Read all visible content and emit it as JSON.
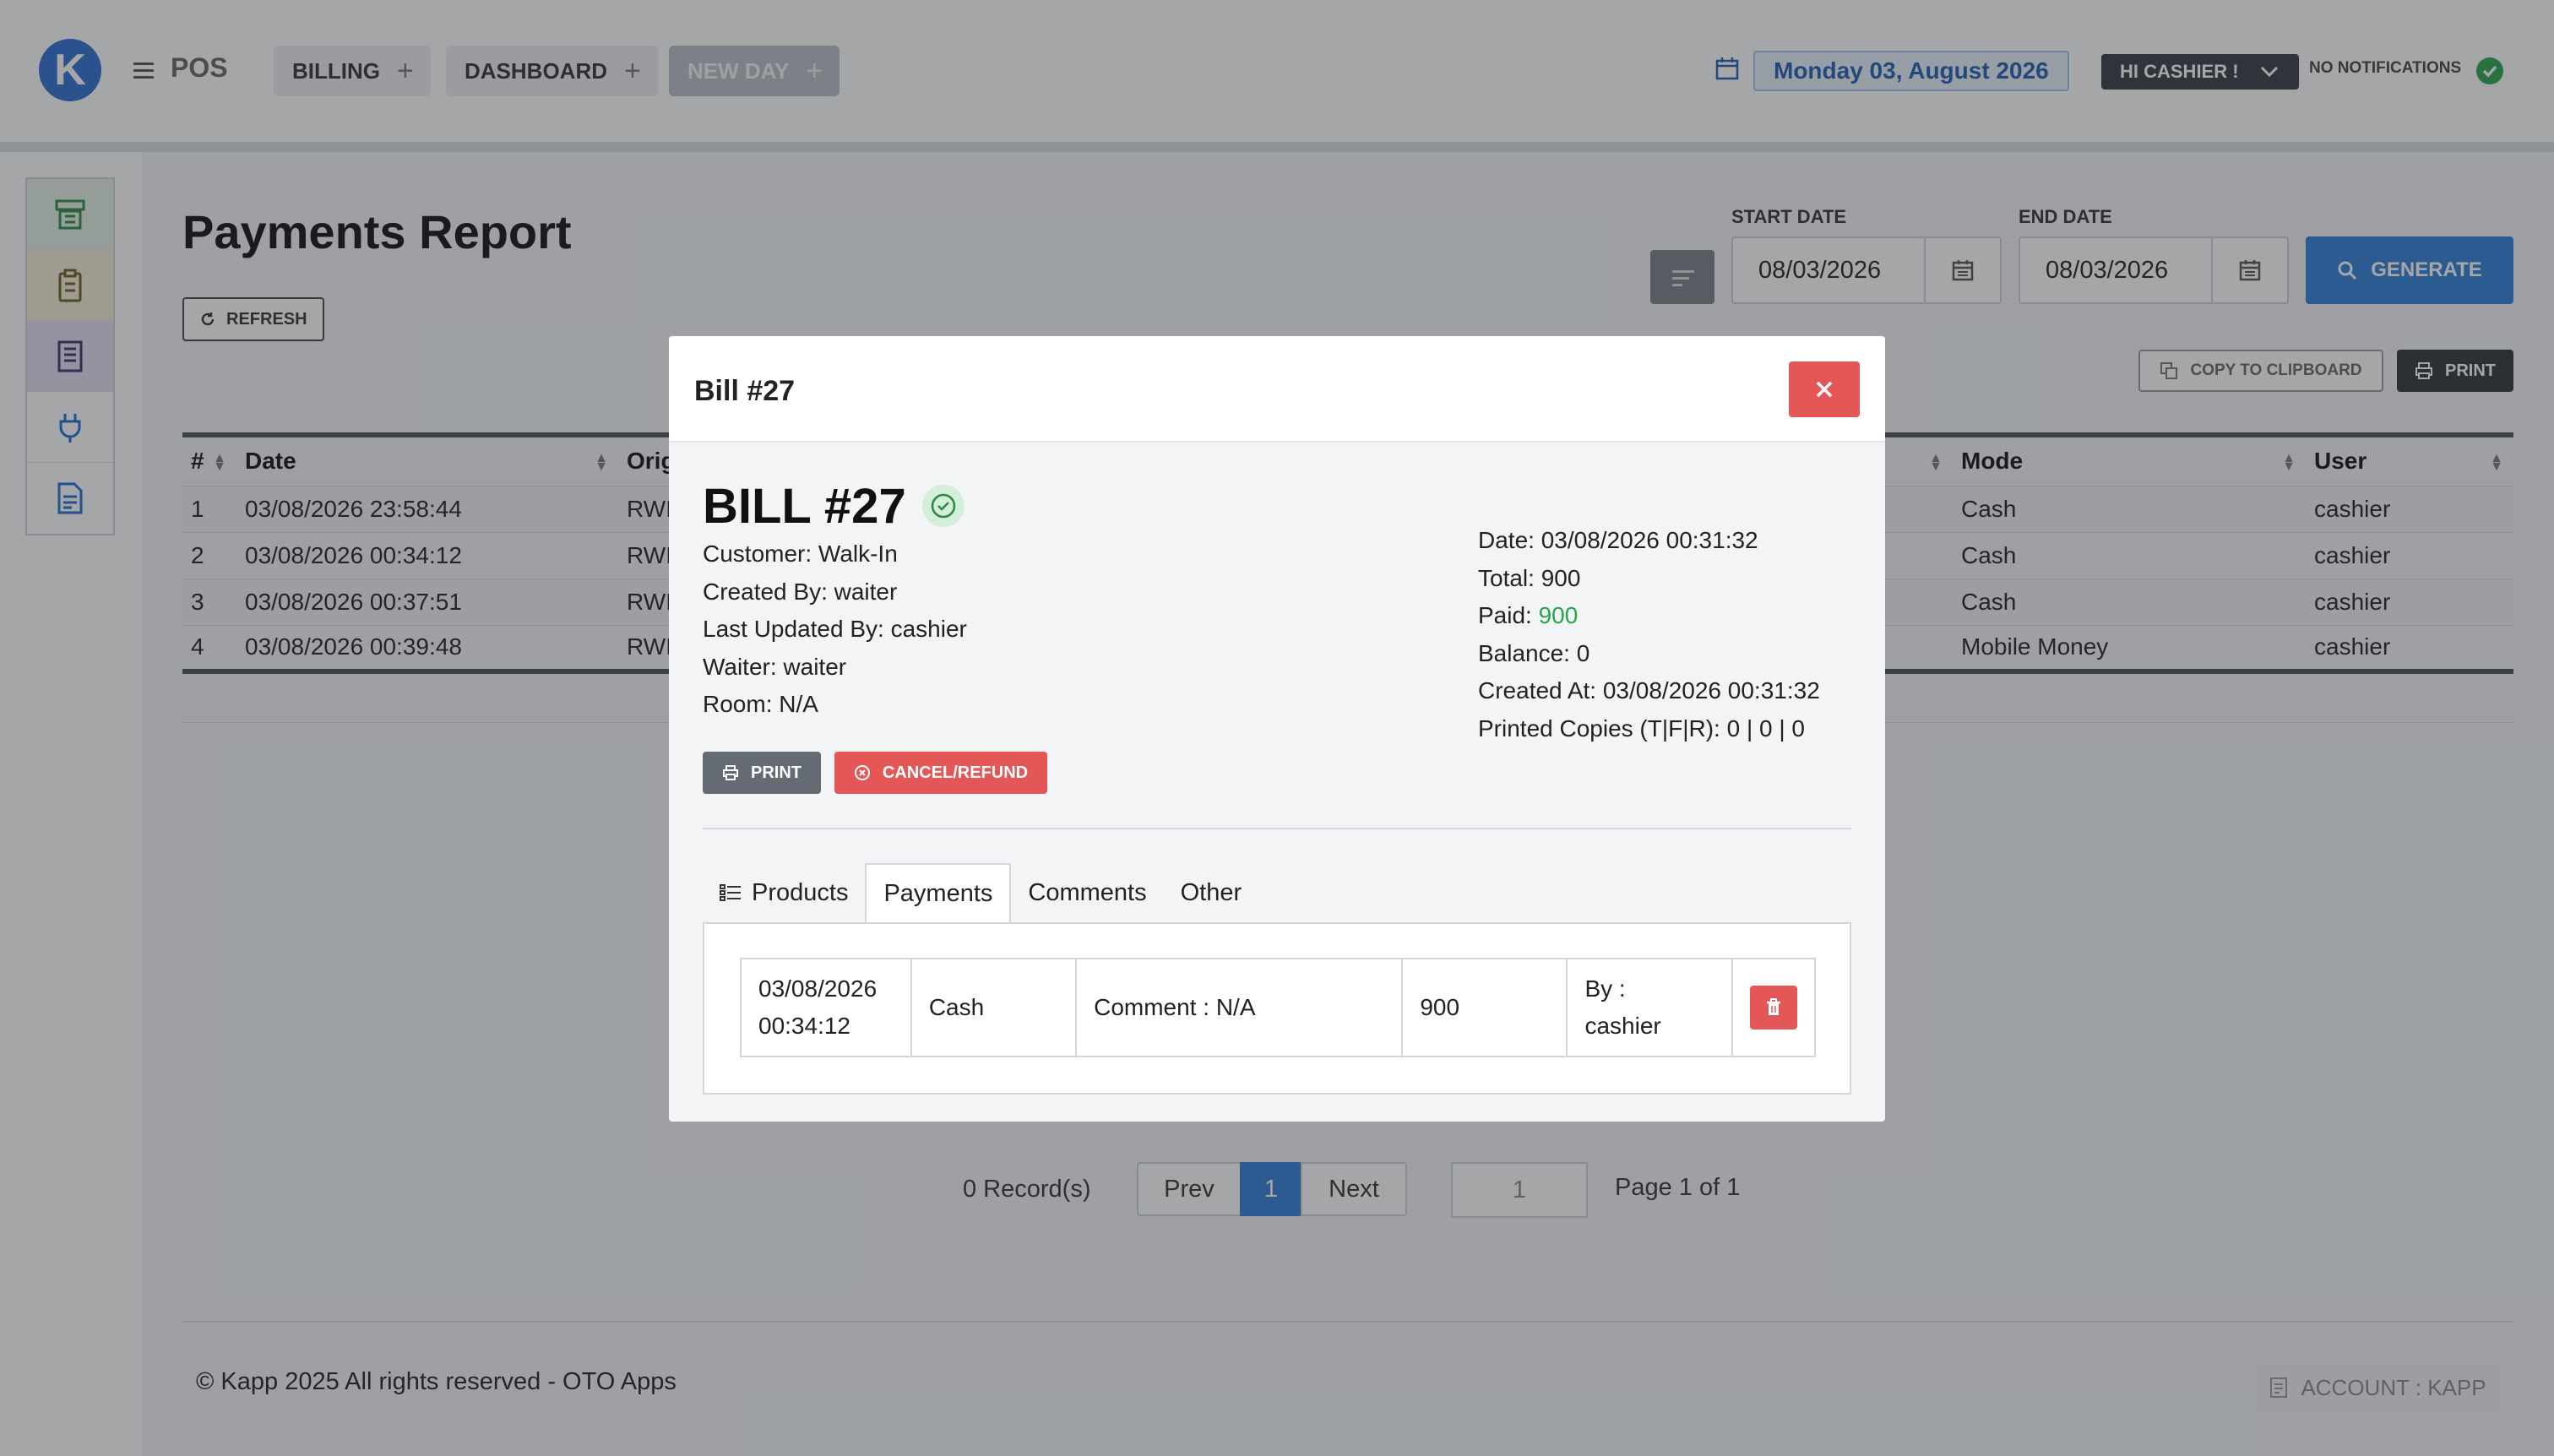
{
  "topbar": {
    "logo_letter": "K",
    "app_name": "POS",
    "tabs": [
      {
        "label": "BILLING",
        "plus": "+"
      },
      {
        "label": "DASHBOARD",
        "plus": "+"
      },
      {
        "label": "NEW DAY",
        "plus": "+"
      }
    ],
    "date": "Monday 03, August 2026",
    "user": "HI CASHIER !",
    "notifications": "NO NOTIFICATIONS"
  },
  "sidebar": {
    "items": [
      {
        "icon": "cash-register-icon",
        "color": "#2c8a4a"
      },
      {
        "icon": "clipboard-icon",
        "color": "#7a6a20"
      },
      {
        "icon": "receipt-icon",
        "color": "#4a3a7a"
      },
      {
        "icon": "plug-icon",
        "color": "#1e6fd0"
      },
      {
        "icon": "document-icon",
        "color": "#1e6fd0"
      }
    ]
  },
  "main": {
    "title": "Payments Report",
    "refresh_label": "REFRESH",
    "start_date_label": "START DATE",
    "start_date": "08/03/2026",
    "end_date_label": "END DATE",
    "end_date": "08/03/2026",
    "generate_label": "GENERATE",
    "copy_label": "COPY TO CLIPBOARD",
    "print_label": "PRINT",
    "table": {
      "columns": [
        "#",
        "Date",
        "Orig",
        "Mode",
        "User"
      ],
      "rows": [
        {
          "num": "1",
          "date": "03/08/2026 23:58:44",
          "orig": "RWI",
          "mode": "Cash",
          "user": "cashier"
        },
        {
          "num": "2",
          "date": "03/08/2026 00:34:12",
          "orig": "RWI",
          "mode": "Cash",
          "user": "cashier"
        },
        {
          "num": "3",
          "date": "03/08/2026 00:37:51",
          "orig": "RWI",
          "mode": "Cash",
          "user": "cashier"
        },
        {
          "num": "4",
          "date": "03/08/2026 00:39:48",
          "orig": "RWI",
          "mode": "Mobile Money",
          "user": "cashier"
        }
      ]
    },
    "pager": {
      "records": "0 Record(s)",
      "prev": "Prev",
      "current": "1",
      "next": "Next",
      "page_input": "1",
      "page_of": "Page 1 of 1"
    },
    "footer": {
      "copyright": "© Kapp 2025 All rights reserved - OTO Apps",
      "account": "ACCOUNT : KAPP"
    }
  },
  "modal": {
    "title": "Bill #27",
    "bill_heading": "BILL #27",
    "left": {
      "customer": "Customer: Walk-In",
      "created_by": "Created By: waiter",
      "updated_by": "Last Updated By: cashier",
      "waiter": "Waiter: waiter",
      "room": "Room: N/A"
    },
    "right": {
      "date": "Date: 03/08/2026 00:31:32",
      "total": "Total: 900",
      "paid_label": "Paid:",
      "paid_value": "900",
      "balance": "Balance: 0",
      "created_at": "Created At: 03/08/2026 00:31:32",
      "printed_copies": "Printed Copies (T|F|R): 0 | 0 | 0"
    },
    "print_label": "PRINT",
    "cancel_label": "CANCEL/REFUND",
    "tabs": [
      "Products",
      "Payments",
      "Comments",
      "Other"
    ],
    "active_tab": "Payments",
    "payment": {
      "date_line1": "03/08/2026",
      "date_line2": "00:34:12",
      "mode": "Cash",
      "comment": "Comment : N/A",
      "amount": "900",
      "by_line1": "By :",
      "by_line2": "cashier"
    }
  },
  "colors": {
    "primary": "#2f7fd8",
    "danger": "#e35757",
    "success": "#2aa44a",
    "dark": "#2e343a"
  }
}
